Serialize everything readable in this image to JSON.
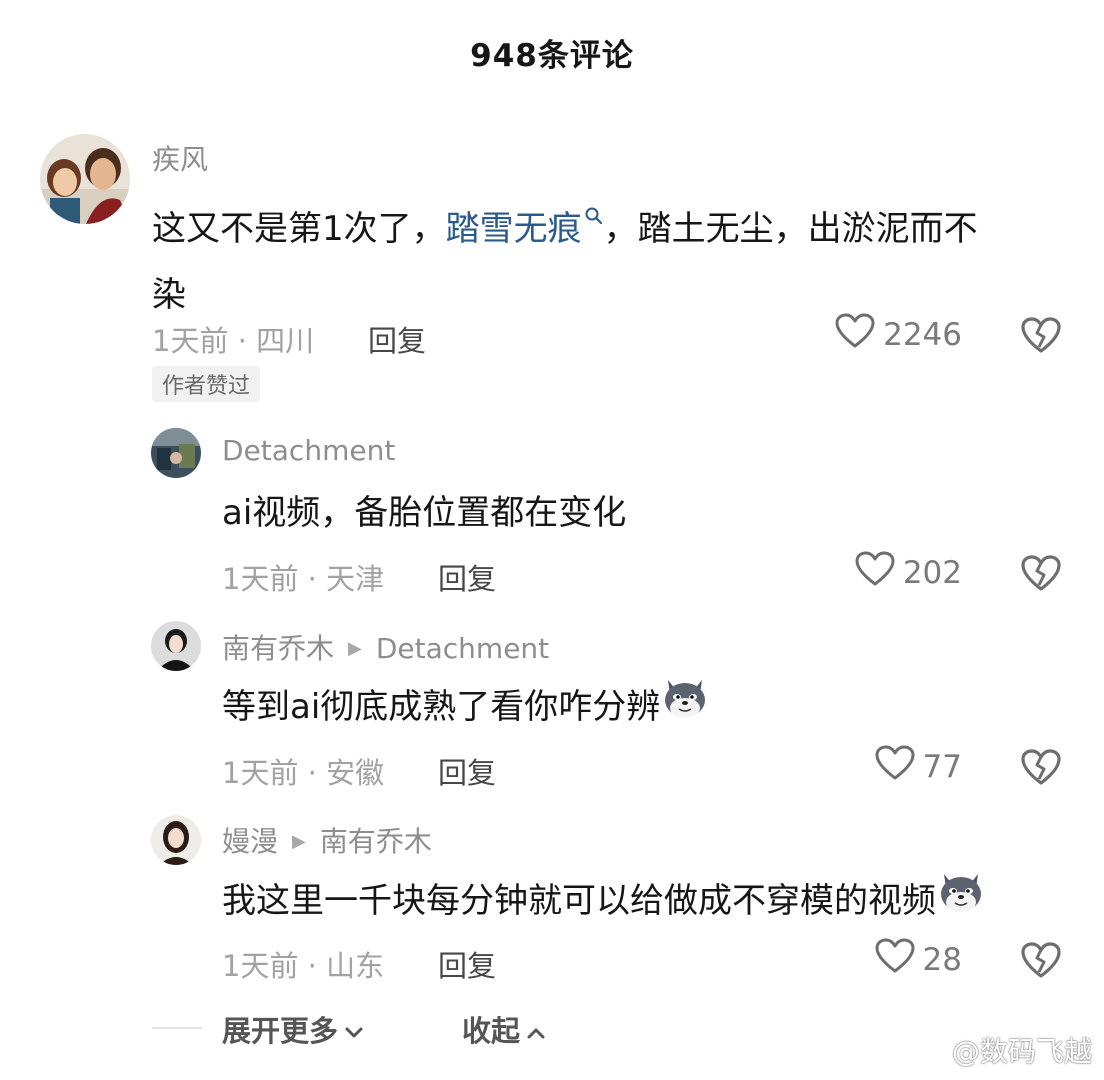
{
  "header": {
    "title": "948条评论"
  },
  "comments": [
    {
      "author": "疾风",
      "text_parts": [
        "这又不是第1次了，",
        "踏雪无痕",
        "，踏土无尘，出淤泥而不",
        "染"
      ],
      "meta": "1天前 · 四川",
      "reply_label": "回复",
      "likes": "2246",
      "badge": "作者赞过"
    },
    {
      "author": "Detachment",
      "text": "ai视频，备胎位置都在变化",
      "meta": "1天前 · 天津",
      "reply_label": "回复",
      "likes": "202"
    },
    {
      "author": "南有乔木",
      "reply_to": "Detachment",
      "text": "等到ai彻底成熟了看你咋分辨",
      "emoji": "dog-emoji",
      "meta": "1天前 · 安徽",
      "reply_label": "回复",
      "likes": "77"
    },
    {
      "author": "嫚漫",
      "reply_to": "南有乔木",
      "text": "我这里一千块每分钟就可以给做成不穿模的视频",
      "emoji": "dog-emoji",
      "meta": "1天前 · 山东",
      "reply_label": "回复",
      "likes": "28"
    }
  ],
  "footer": {
    "expand_label": "展开更多",
    "collapse_label": "收起"
  },
  "watermark": {
    "text": "@数码飞越",
    "icon": "weibo-icon"
  },
  "icons": {
    "like": "heart-outline-icon",
    "dislike": "broken-heart-icon",
    "search": "search-icon"
  },
  "colors": {
    "link": "#2b5a8c",
    "meta": "#a2a2a2",
    "name": "#8e8e8e"
  }
}
